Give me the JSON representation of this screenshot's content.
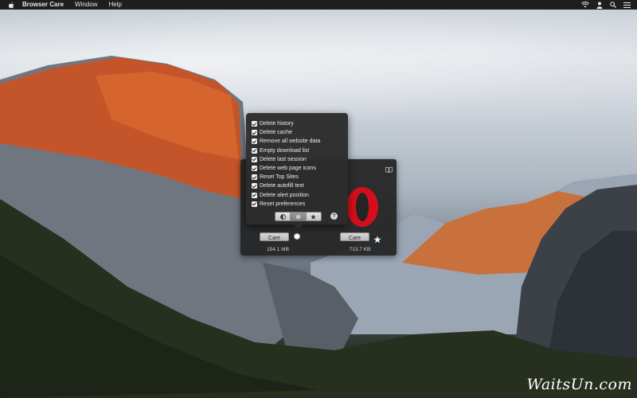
{
  "menubar": {
    "app_name": "Browser Care",
    "items": [
      "Window",
      "Help"
    ],
    "icons": [
      "apple-logo-icon",
      "wifi-icon",
      "user-icon",
      "search-icon",
      "list-icon"
    ]
  },
  "options": [
    {
      "label": "Delete history",
      "checked": true
    },
    {
      "label": "Delete cache",
      "checked": true
    },
    {
      "label": "Remove all website data",
      "checked": true
    },
    {
      "label": "Empty download list",
      "checked": true
    },
    {
      "label": "Delete last session",
      "checked": true
    },
    {
      "label": "Delete web page icons",
      "checked": true
    },
    {
      "label": "Reset Top Sites",
      "checked": true
    },
    {
      "label": "Delete autofill text",
      "checked": true
    },
    {
      "label": "Delete alert position",
      "checked": true
    },
    {
      "label": "Reset preferences",
      "checked": true
    }
  ],
  "segmented": {
    "buttons": [
      "contrast-icon",
      "circle-icon",
      "star-icon"
    ],
    "active_index": 1
  },
  "help_label": "?",
  "browsers": [
    {
      "care_label": "Care",
      "size": "154.1 MB"
    },
    {
      "care_label": "Care",
      "size": "713.7 KB",
      "logo": "opera-logo-icon"
    }
  ],
  "colors": {
    "opera_red": "#d40f1c",
    "panel_bg": "#242424",
    "menubar_bg": "#1e1e1e"
  },
  "watermark": "WaitsUn.com"
}
